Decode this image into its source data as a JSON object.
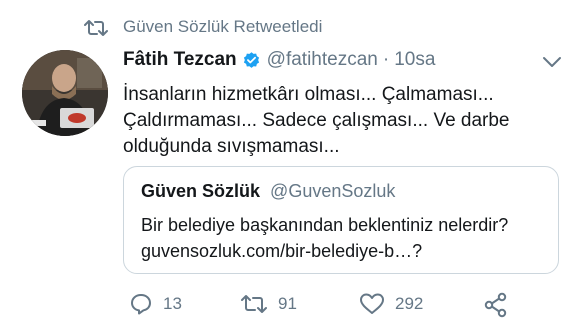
{
  "retweet": {
    "label": "Güven Sözlük Retweetledi",
    "icon": "retweet-icon"
  },
  "tweet": {
    "author_name": "Fâtih Tezcan",
    "handle": "@fatihtezcan",
    "separator": "·",
    "time": "10sa",
    "verified": true,
    "text": "İnsanların hizmetkârı olması... Çalmaması... Çaldırmaması... Sadece çalışması... Ve darbe olduğunda sıvışmaması..."
  },
  "quote": {
    "author_name": "Güven Sözlük",
    "handle": "@GuvenSozluk",
    "text": "Bir belediye başkanından beklentiniz nelerdir?  guvensozluk.com/bir-belediye-b…?"
  },
  "actions": {
    "replies": "13",
    "retweets": "91",
    "likes": "292"
  },
  "colors": {
    "accent": "#1da1f2",
    "muted": "#657786",
    "border": "#ccd6dd",
    "text": "#14171a"
  }
}
